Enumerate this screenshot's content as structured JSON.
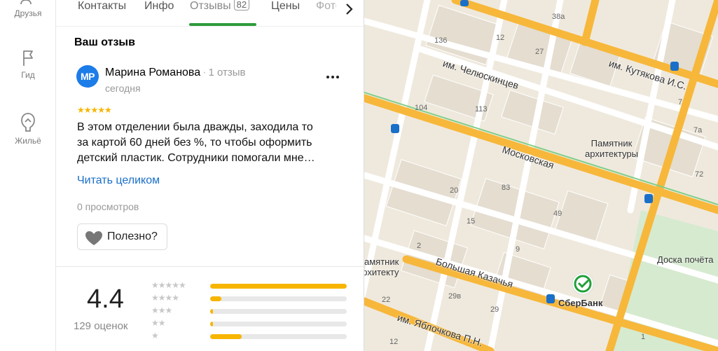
{
  "nav": {
    "friends": "Друзья",
    "guide": "Гид",
    "housing": "Жильё"
  },
  "tabs": {
    "contacts": "Контакты",
    "info": "Инфо",
    "reviews": "Отзывы",
    "reviews_count": "82",
    "prices": "Цены",
    "photo": "Фото"
  },
  "review": {
    "section_title": "Ваш отзыв",
    "avatar_initials": "МР",
    "author": "Марина Романова",
    "author_reviews": "1 отзыв",
    "date": "сегодня",
    "stars": "★★★★★",
    "rating": 5,
    "text_lines": [
      "В этом отделении была дважды, заходила то",
      "за картой 60 дней без %, то чтобы оформить",
      "детский пластик. Сотрудники помогали мне…"
    ],
    "read_more": "Читать целиком",
    "views": "0 просмотров",
    "useful": "Полезно?"
  },
  "summary": {
    "rating": "4.4",
    "count": "129 оценок",
    "distribution": [
      {
        "stars": "★★★★★",
        "fraction": 1.0
      },
      {
        "stars": "★★★★",
        "fraction": 0.08
      },
      {
        "stars": "★★★",
        "fraction": 0.02
      },
      {
        "stars": "★★",
        "fraction": 0.02
      },
      {
        "stars": "★",
        "fraction": 0.23
      }
    ]
  },
  "map": {
    "streets": {
      "chelyuskintsev": "им. Челюскинцев",
      "kutyakova": "им. Кутякова И.С.",
      "moskovskaya": "Московская",
      "kazachya": "Большая Казачья",
      "yablochkova": "им. Яблочкова П.Н."
    },
    "poi": {
      "monument1": "Памятник\nархитектуры",
      "monument2": "Памятник\nархитектуры",
      "board": "Доска почёта",
      "bank": "СберБанк"
    },
    "house_numbers": [
      "38а",
      "27",
      "136",
      "12",
      "7",
      "104",
      "113",
      "7а",
      "72",
      "20",
      "83",
      "49",
      "15",
      "29в",
      "29",
      "2",
      "9",
      "22",
      "12",
      "1"
    ],
    "colors": {
      "major_road": "#f7b73a",
      "bank": "#21a038"
    }
  }
}
